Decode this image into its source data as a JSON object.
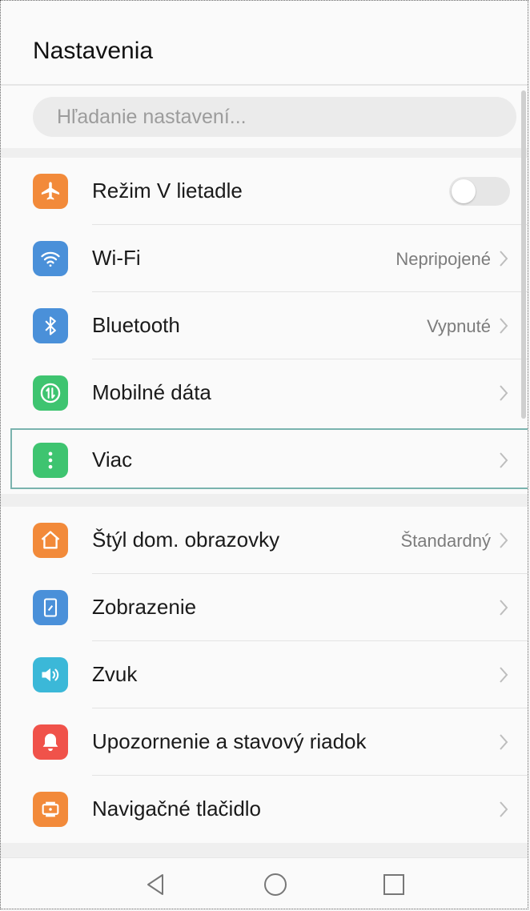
{
  "header": {
    "title": "Nastavenia"
  },
  "search": {
    "placeholder": "Hľadanie nastavení..."
  },
  "sections": [
    {
      "items": [
        {
          "id": "airplane",
          "label": "Režim V lietadle",
          "icon": "airplane-icon",
          "icon_color": "#f28a3a",
          "control": "toggle",
          "toggle_on": false
        },
        {
          "id": "wifi",
          "label": "Wi-Fi",
          "icon": "wifi-icon",
          "icon_color": "#4a90d9",
          "value": "Nepripojené"
        },
        {
          "id": "bluetooth",
          "label": "Bluetooth",
          "icon": "bluetooth-icon",
          "icon_color": "#4a90d9",
          "value": "Vypnuté"
        },
        {
          "id": "mobile-data",
          "label": "Mobilné dáta",
          "icon": "mobile-data-icon",
          "icon_color": "#3ec470"
        },
        {
          "id": "more",
          "label": "Viac",
          "icon": "more-icon",
          "icon_color": "#3ec470",
          "focused": true
        }
      ]
    },
    {
      "items": [
        {
          "id": "home-style",
          "label": "Štýl dom. obrazovky",
          "icon": "home-icon",
          "icon_color": "#f28a3a",
          "value": "Štandardný"
        },
        {
          "id": "display",
          "label": "Zobrazenie",
          "icon": "display-icon",
          "icon_color": "#4a90d9"
        },
        {
          "id": "sound",
          "label": "Zvuk",
          "icon": "sound-icon",
          "icon_color": "#3bb8d8"
        },
        {
          "id": "notifications",
          "label": "Upozornenie a stavový riadok",
          "icon": "bell-icon",
          "icon_color": "#f0524a"
        },
        {
          "id": "nav-key",
          "label": "Navigačné tlačidlo",
          "icon": "navigation-key-icon",
          "icon_color": "#f28a3a"
        }
      ]
    }
  ],
  "navbar": {
    "buttons": [
      "back-icon",
      "home-circle-icon",
      "recents-icon"
    ]
  }
}
